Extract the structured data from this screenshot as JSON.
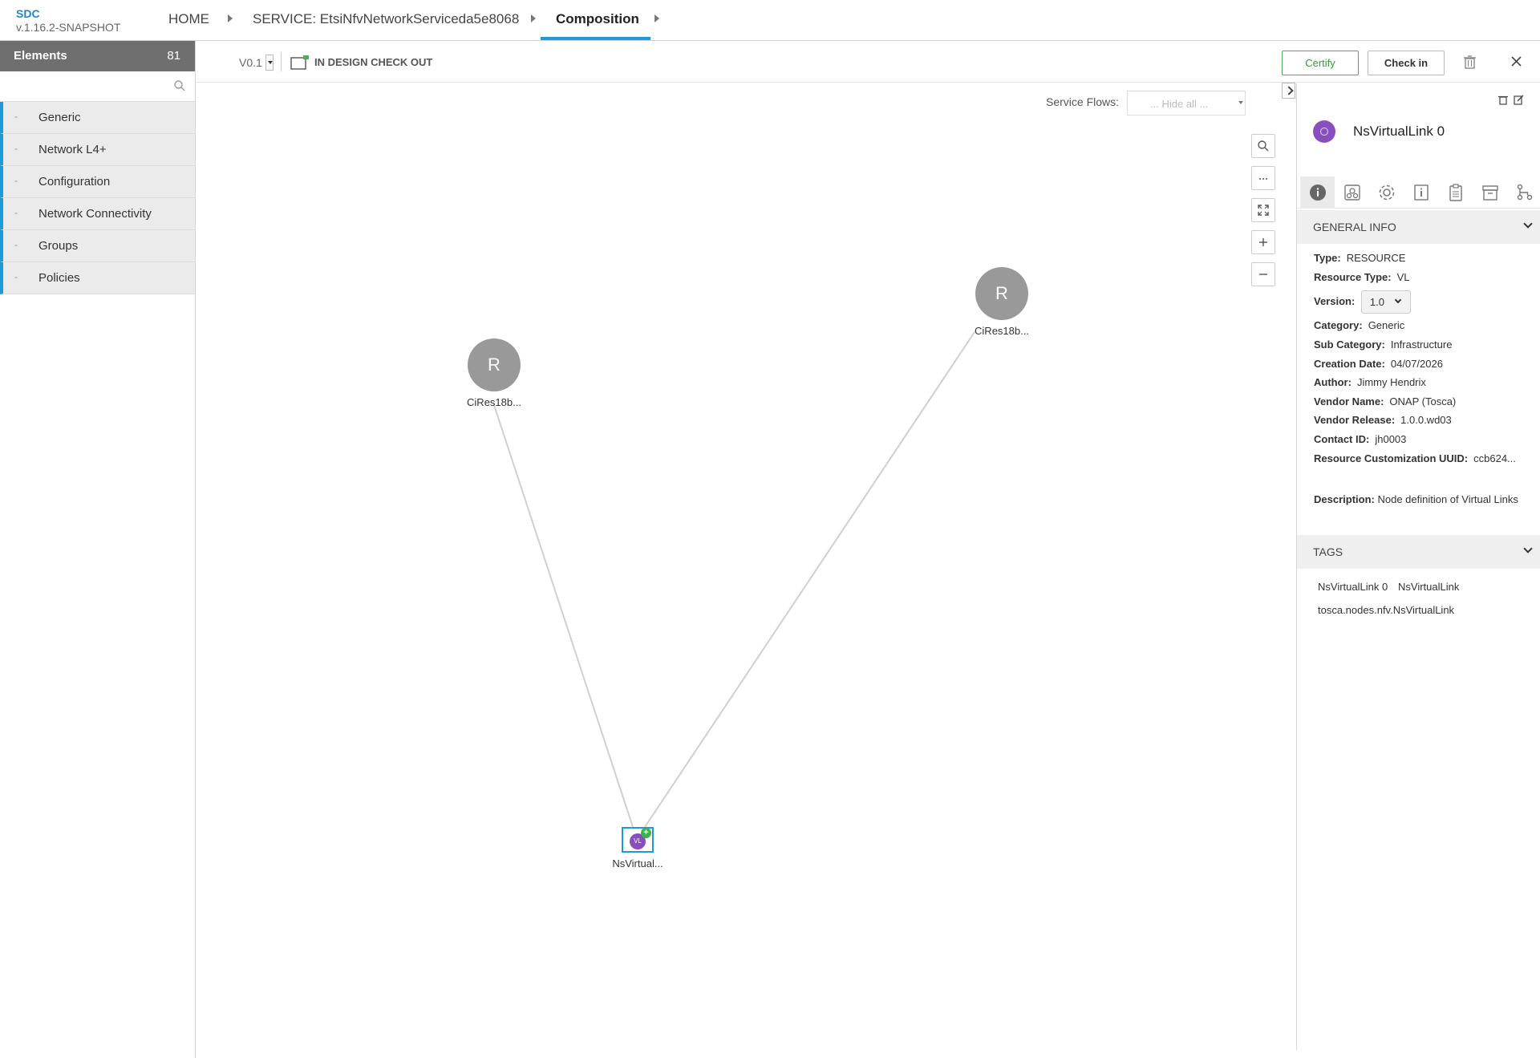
{
  "app": {
    "name": "SDC",
    "version": "v.1.16.2-SNAPSHOT"
  },
  "breadcrumbs": [
    "HOME",
    "SERVICE: EtsiNfvNetworkServiceda5e8068",
    "Composition"
  ],
  "sidebar": {
    "title": "Elements",
    "count": "81",
    "search_placeholder": "",
    "items": [
      {
        "label": "Generic"
      },
      {
        "label": "Network L4+"
      },
      {
        "label": "Configuration"
      },
      {
        "label": "Network Connectivity"
      },
      {
        "label": "Groups"
      },
      {
        "label": "Policies"
      }
    ]
  },
  "toolbar": {
    "version": "V0.1",
    "status": "IN DESIGN CHECK OUT",
    "certify_label": "Certify",
    "checkin_label": "Check in"
  },
  "canvas": {
    "service_flows_label": "Service Flows:",
    "service_flows_value": "... Hide all ...",
    "nodes": [
      {
        "letter": "R",
        "label": "CiRes18b..."
      },
      {
        "letter": "R",
        "label": "CiRes18b..."
      },
      {
        "letter": "VL",
        "label": "NsVirtual..."
      }
    ]
  },
  "panel": {
    "title": "NsVirtualLink 0",
    "general_info_title": "GENERAL INFO",
    "info": {
      "type_label": "Type:",
      "type": "RESOURCE",
      "resource_type_label": "Resource Type:",
      "resource_type": "VL",
      "version_label": "Version:",
      "version": "1.0",
      "category_label": "Category:",
      "category": "Generic",
      "sub_category_label": "Sub Category:",
      "sub_category": "Infrastructure",
      "creation_date_label": "Creation Date:",
      "creation_date": "04/07/2026",
      "author_label": "Author:",
      "author": "Jimmy Hendrix",
      "vendor_name_label": "Vendor Name:",
      "vendor_name": "ONAP (Tosca)",
      "vendor_release_label": "Vendor Release:",
      "vendor_release": "1.0.0.wd03",
      "contact_id_label": "Contact ID:",
      "contact_id": "jh0003",
      "uuid_label": "Resource Customization UUID:",
      "uuid": "ccb624...",
      "description_label": "Description:",
      "description": "Node definition of Virtual Links"
    },
    "tags_title": "TAGS",
    "tags": [
      "NsVirtualLink 0",
      "NsVirtualLink",
      "tosca.nodes.nfv.NsVirtualLink"
    ]
  },
  "colors": {
    "accent": "#1e9ad6",
    "certify": "#4caf50",
    "node": "#999999",
    "vl_node": "#8a4fbf"
  }
}
